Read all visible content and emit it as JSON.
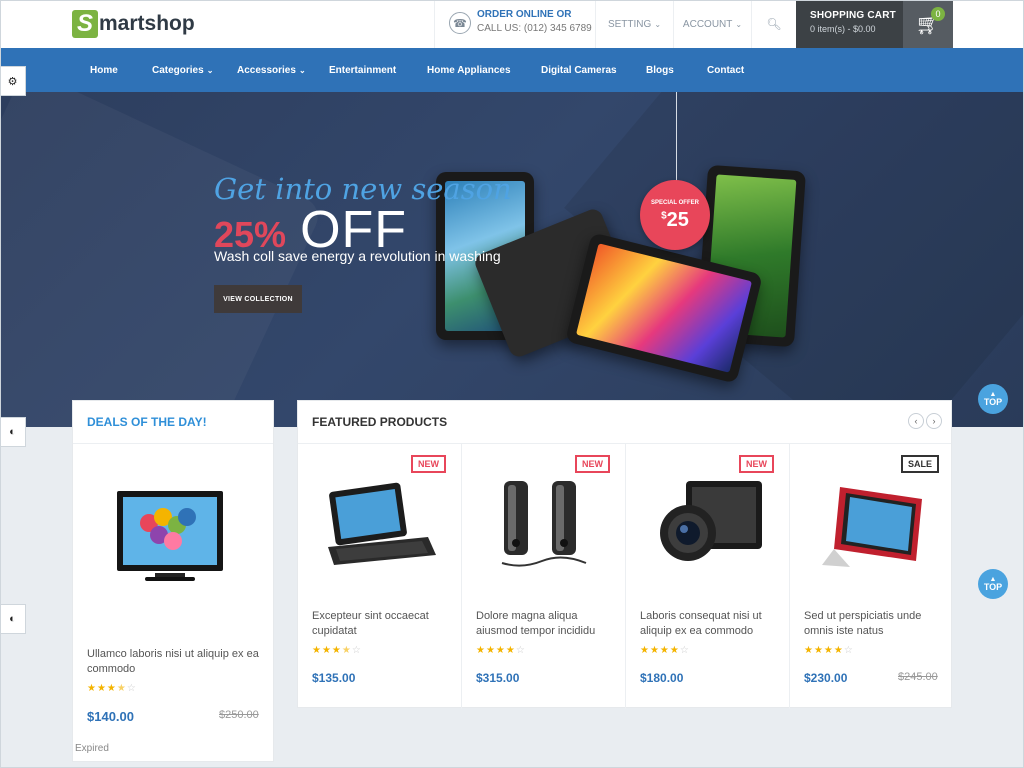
{
  "header": {
    "logo_letter": "S",
    "logo_text": "martshop",
    "contact": {
      "title": "ORDER ONLINE OR",
      "phone": "CALL US: (012) 345 6789"
    },
    "setting_label": "SETTING",
    "account_label": "ACCOUNT",
    "cart": {
      "title": "SHOPPING CART",
      "summary": "0 item(s) - $0.00",
      "count": "0"
    }
  },
  "nav": {
    "items": [
      {
        "label": "Home",
        "has_dropdown": false
      },
      {
        "label": "Categories",
        "has_dropdown": true
      },
      {
        "label": "Accessories",
        "has_dropdown": true
      },
      {
        "label": "Entertainment",
        "has_dropdown": false
      },
      {
        "label": "Home Appliances",
        "has_dropdown": false
      },
      {
        "label": "Digital Cameras",
        "has_dropdown": false
      },
      {
        "label": "Blogs",
        "has_dropdown": false
      },
      {
        "label": "Contact",
        "has_dropdown": false
      }
    ]
  },
  "hero": {
    "tagline": "Get into new season",
    "discount": "25%",
    "off_word": "OFF",
    "description": "Wash coll save energy a revolution in washing",
    "button_label": "VIEW COLLECTION",
    "badge_label": "SPECIAL OFFER",
    "badge_currency": "$",
    "badge_price": "25"
  },
  "top_button_label": "TOP",
  "deals": {
    "title": "DEALS OF THE DAY!",
    "product": {
      "name": "Ullamco laboris nisi ut aliquip ex ea commodo",
      "rating": 3.5,
      "price": "$140.00",
      "old_price": "$250.00",
      "status": "Expired"
    }
  },
  "featured": {
    "title": "FEATURED PRODUCTS",
    "products": [
      {
        "name": "Excepteur sint occaecat cupidatat",
        "badge": "NEW",
        "rating": 3.5,
        "price": "$135.00",
        "old_price": "",
        "icon": "tablet-keyboard"
      },
      {
        "name": "Dolore magna aliqua aiusmod tempor incididu",
        "badge": "NEW",
        "rating": 4,
        "price": "$315.00",
        "old_price": "",
        "icon": "speakers"
      },
      {
        "name": "Laboris consequat nisi ut aliquip ex ea commodo",
        "badge": "NEW",
        "rating": 4,
        "price": "$180.00",
        "old_price": "",
        "icon": "camera"
      },
      {
        "name": "Sed ut perspiciatis unde omnis iste natus",
        "badge": "SALE",
        "rating": 4,
        "price": "$230.00",
        "old_price": "$245.00",
        "icon": "tablet-stand"
      }
    ]
  },
  "colors": {
    "brand_blue": "#2f72b7",
    "accent_red": "#e8465a",
    "logo_green": "#7cb342",
    "star": "#f4b400"
  }
}
